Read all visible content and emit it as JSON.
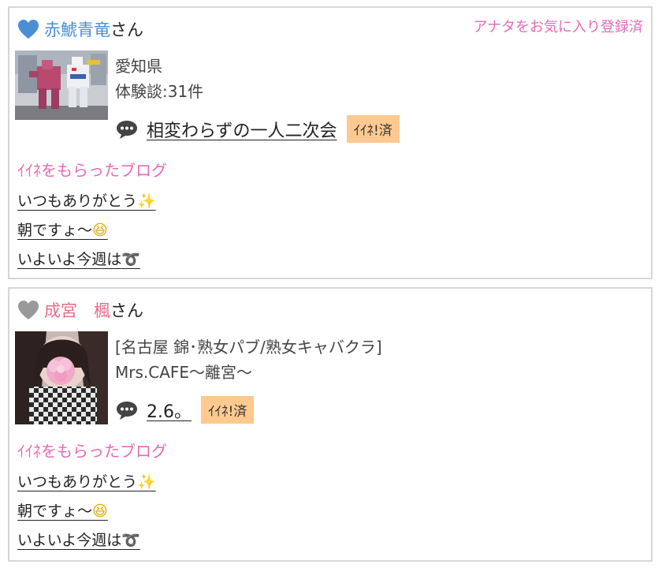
{
  "cards": [
    {
      "name": "赤鯱青竜",
      "honorific": "さん",
      "name_color": "#4a8fd4",
      "heart_color": "#4a8fd4",
      "favorite_note": "アナタをお気に入り登録済",
      "info_lines": [
        "愛知県",
        "体験談:31件"
      ],
      "blog_title": "相変わらずの一人二次会",
      "iine_badge": "ｲｲﾈ!済",
      "section_label": "ｲｲﾈをもらったブログ",
      "liked_posts": [
        {
          "text": "いつもありがとう",
          "emoji": "✨"
        },
        {
          "text": "朝ですょ〜",
          "emoji": "😆"
        },
        {
          "text": "いよいよ今週は",
          "emoji": "➰"
        }
      ]
    },
    {
      "name": "成宮　楓",
      "honorific": "さん",
      "name_color": "#e86a8a",
      "heart_color": "#999999",
      "favorite_note": "",
      "info_lines": [
        "[名古屋 錦･熟女パブ/熟女キャバクラ]",
        "Mrs.CAFE〜離宮〜"
      ],
      "blog_title": "2.6。",
      "iine_badge": "ｲｲﾈ!済",
      "section_label": "ｲｲﾈをもらったブログ",
      "liked_posts": [
        {
          "text": "いつもありがとう",
          "emoji": "✨"
        },
        {
          "text": "朝ですょ〜",
          "emoji": "😆"
        },
        {
          "text": "いよいよ今週は",
          "emoji": "➰"
        }
      ]
    }
  ],
  "colors": {
    "accent_pink": "#e869b6",
    "badge_bg": "#ffc98f",
    "border": "#d6d6d6"
  }
}
